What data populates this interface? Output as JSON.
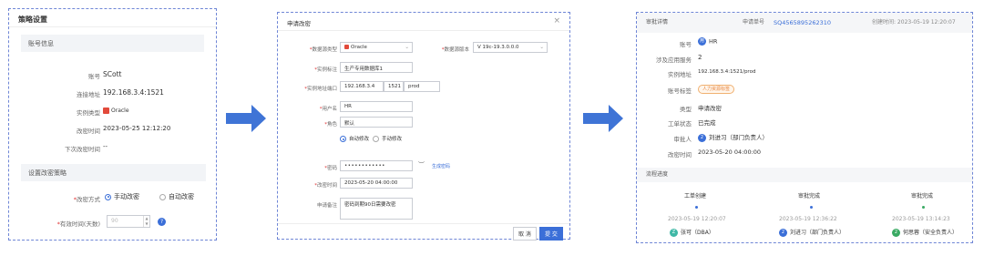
{
  "panel1": {
    "title": "策略设置",
    "section_account": "账号信息",
    "account_label": "账号",
    "account_value": "SCott",
    "address_label": "连接地址",
    "address_value": "192.168.3.4:1521",
    "instance_type_label": "实例类型",
    "instance_type_value": "Oracle",
    "modified_label": "改密时间",
    "modified_value": "2023-05-25 12:12:20",
    "next_label": "下次改密时间",
    "next_value": "--",
    "section_policy": "设置改密策略",
    "mode_label": "改密方式",
    "mode_manual": "手动改密",
    "mode_auto": "自动改密",
    "valid_label": "有效时间(天数)",
    "valid_placeholder": "90",
    "help_icon": "?"
  },
  "panel2": {
    "title": "申请改密",
    "db_type_label": "数据源类型",
    "db_type_value": "Oracle",
    "db_version_label": "数据源版本",
    "db_version_value": "V 19c-19.3.0.0.0",
    "instance_label": "实例标注",
    "instance_value": "生产专用数据库1",
    "addr_label": "实例地址端口",
    "addr_ip": "192.168.3.4",
    "addr_port": "1521",
    "addr_service": "prod",
    "user_label": "用户名",
    "user_value": "HR",
    "role_label": "角色",
    "role_value": "默认",
    "opt_auto": "自动修改",
    "opt_manual": "手动修改",
    "pwd_label": "密码",
    "pwd_value": "••••••••••••",
    "gen_pwd": "生成密码",
    "time_label": "改密时间",
    "time_value": "2023-05-20 04:00:00",
    "note_label": "申请备注",
    "note_value": "密码到期90日需要改密",
    "cancel": "取 消",
    "submit": "提 交"
  },
  "panel3": {
    "title": "审批详情",
    "order_label": "申请单号",
    "order_value": "SQ4565895262310",
    "created": "创建时间: 2023-05-19 12:20:07",
    "account_label": "账号",
    "account_value": "HR",
    "service_label": "涉及应用服务",
    "service_value": "2",
    "addr_label": "实例地址",
    "addr_value": "192.168.3.4:1521/prod",
    "tag_label": "账号标签",
    "tag_value": "人力资源标签",
    "type_label": "类型",
    "type_value": "申请改密",
    "status_label": "工单状态",
    "status_value": "已完成",
    "approver_label": "审批人",
    "approver_value": "刘进习（部门负责人）",
    "change_time_label": "改密时间",
    "change_time_value": "2023-05-20 04:00:00",
    "progress_title": "流程进度",
    "steps": [
      {
        "title": "工单创建",
        "time": "2023-05-19 12:20:07",
        "person": "张可（DBA）",
        "avatar": "Z"
      },
      {
        "title": "审批完成",
        "time": "2023-05-19 12:36:22",
        "person": "刘进习（部门负责人）",
        "avatar": "2"
      },
      {
        "title": "审批完成",
        "time": "2023-05-19 13:14:23",
        "person": "何思蓉（安全负责人）",
        "avatar": "2"
      }
    ]
  },
  "colors": {
    "accent": "#3b6fd8",
    "arrow": "#3f74d6",
    "border": "#6f86d6"
  }
}
